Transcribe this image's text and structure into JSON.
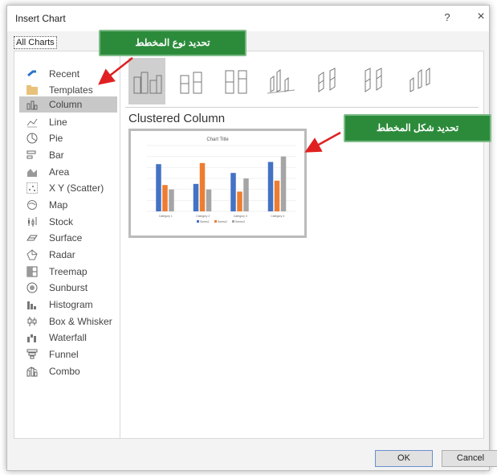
{
  "window": {
    "title": "Insert Chart",
    "help": "?",
    "close": "×"
  },
  "tabs": {
    "all_charts": "All Charts"
  },
  "sidebar": {
    "items": [
      {
        "label": "Recent",
        "icon": "recent-icon"
      },
      {
        "label": "Templates",
        "icon": "folder-icon"
      },
      {
        "label": "Column",
        "icon": "column-chart-icon",
        "selected": true
      },
      {
        "label": "Line",
        "icon": "line-chart-icon"
      },
      {
        "label": "Pie",
        "icon": "pie-chart-icon"
      },
      {
        "label": "Bar",
        "icon": "bar-chart-icon"
      },
      {
        "label": "Area",
        "icon": "area-chart-icon"
      },
      {
        "label": "X Y (Scatter)",
        "icon": "scatter-chart-icon"
      },
      {
        "label": "Map",
        "icon": "map-chart-icon"
      },
      {
        "label": "Stock",
        "icon": "stock-chart-icon"
      },
      {
        "label": "Surface",
        "icon": "surface-chart-icon"
      },
      {
        "label": "Radar",
        "icon": "radar-chart-icon"
      },
      {
        "label": "Treemap",
        "icon": "treemap-chart-icon"
      },
      {
        "label": "Sunburst",
        "icon": "sunburst-chart-icon"
      },
      {
        "label": "Histogram",
        "icon": "histogram-chart-icon"
      },
      {
        "label": "Box & Whisker",
        "icon": "box-whisker-chart-icon"
      },
      {
        "label": "Waterfall",
        "icon": "waterfall-chart-icon"
      },
      {
        "label": "Funnel",
        "icon": "funnel-chart-icon"
      },
      {
        "label": "Combo",
        "icon": "combo-chart-icon"
      }
    ]
  },
  "subtypes": {
    "selected_title": "Clustered Column",
    "count": 7
  },
  "preview": {
    "chart_data": {
      "type": "bar",
      "title": "Chart Title",
      "categories": [
        "Category 1",
        "Category 2",
        "Category 3",
        "Category 4"
      ],
      "series": [
        {
          "name": "Series1",
          "values": [
            4.3,
            2.5,
            3.5,
            4.5
          ]
        },
        {
          "name": "Series2",
          "values": [
            2.4,
            4.4,
            1.8,
            2.8
          ]
        },
        {
          "name": "Series3",
          "values": [
            2.0,
            2.0,
            3.0,
            5.0
          ]
        }
      ],
      "ylim": [
        0,
        6
      ],
      "colors": [
        "#4472c4",
        "#ed7d31",
        "#a5a5a5"
      ],
      "grid": true,
      "legend": "bottom"
    }
  },
  "buttons": {
    "ok": "OK",
    "cancel": "Cancel"
  },
  "annotations": {
    "chart_type": "تحديد نوع المخطط",
    "chart_shape": "تحديد شكل المخطط",
    "accent": "#2c8b3b",
    "arrow_color": "#e02020"
  }
}
